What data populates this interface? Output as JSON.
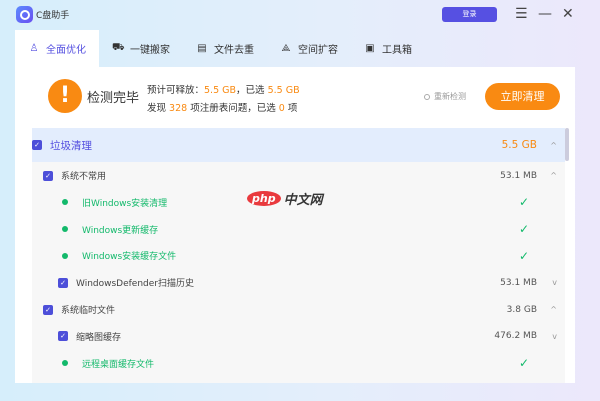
{
  "app": {
    "title": "C盘助手",
    "login": "登录",
    "menu_icon": "hamburger-icon",
    "min_icon": "minimize-icon",
    "close_icon": "close-icon"
  },
  "tabs": [
    {
      "label": "全面优化",
      "icon": "rocket-icon",
      "active": true
    },
    {
      "label": "一键搬家",
      "icon": "truck-icon"
    },
    {
      "label": "文件去重",
      "icon": "document-icon"
    },
    {
      "label": "空间扩容",
      "icon": "expand-icon"
    },
    {
      "label": "工具箱",
      "icon": "toolbox-icon"
    }
  ],
  "summary": {
    "status": "检测完毕",
    "line1_prefix": "预计可释放：",
    "releasable": "5.5 GB",
    "line1_mid": "，已选",
    "selected_size": "5.5 GB",
    "line2_prefix": "发现",
    "issues": "328",
    "line2_mid": "项注册表问题，已选",
    "selected_issues": "0",
    "line2_suffix": "项",
    "rescan": "重新检测",
    "clean": "立即清理"
  },
  "list": {
    "category": {
      "label": "垃圾清理",
      "size": "5.5 GB"
    },
    "rows": [
      {
        "type": "group",
        "label": "系统不常用",
        "size": "53.1 MB",
        "chev": "^"
      },
      {
        "type": "done",
        "label": "旧Windows安装清理"
      },
      {
        "type": "done",
        "label": "Windows更新缓存"
      },
      {
        "type": "done",
        "label": "Windows安装缓存文件"
      },
      {
        "type": "item",
        "label": "WindowsDefender扫描历史",
        "size": "53.1 MB",
        "chev": "v"
      },
      {
        "type": "group",
        "label": "系统临时文件",
        "size": "3.8 GB",
        "chev": "^"
      },
      {
        "type": "item",
        "label": "缩略图缓存",
        "size": "476.2 MB",
        "chev": "v"
      },
      {
        "type": "done",
        "label": "远程桌面缓存文件"
      }
    ]
  },
  "watermark": {
    "a": "php",
    "b": "中文网"
  }
}
